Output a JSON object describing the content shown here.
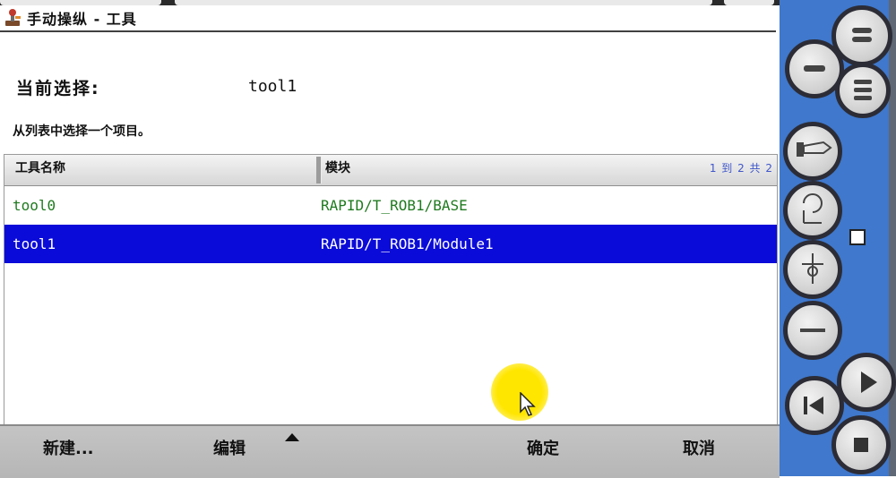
{
  "window": {
    "title": "手动操纵 - 工具",
    "icon": "robot-jog-icon"
  },
  "panel": {
    "current_selection_label": "当前选择:",
    "current_selection_value": "tool1",
    "instruction": "从列表中选择一个项目。"
  },
  "table": {
    "columns": [
      "工具名称",
      "模块"
    ],
    "page_indicator": "1 到 2 共 2",
    "rows": [
      {
        "name": "tool0",
        "module": "RAPID/T_ROB1/BASE",
        "selected": false
      },
      {
        "name": "tool1",
        "module": "RAPID/T_ROB1/Module1",
        "selected": true
      }
    ]
  },
  "commands": {
    "new": "新建...",
    "edit": "编辑",
    "ok": "确定",
    "cancel": "取消"
  },
  "colors": {
    "selection": "#0b0bd9",
    "row_text": "#1f7a1f",
    "command_bar": "#bdbdbd",
    "pendant_blue": "#3f78cc"
  },
  "hardware": {
    "buttons": [
      "enable-icon",
      "minus-icon",
      "menu-icon",
      "list-icon",
      "tool-icon",
      "rotate-icon",
      "jog-mode-icon",
      "more-icon",
      "play-icon",
      "step-back-icon",
      "stop-icon"
    ]
  }
}
